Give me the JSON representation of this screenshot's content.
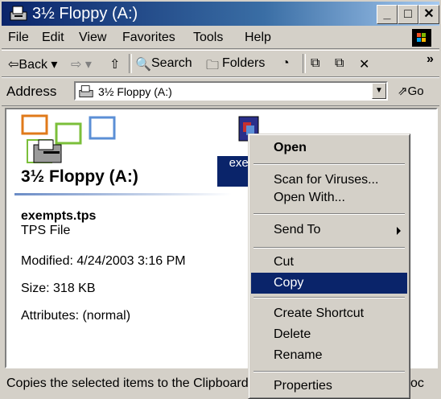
{
  "window": {
    "title": "3½ Floppy (A:)"
  },
  "menu": [
    "File",
    "Edit",
    "View",
    "Favorites",
    "Tools",
    "Help"
  ],
  "toolbar": {
    "back": "⇦Back ▾",
    "forward": "⇨ ▾",
    "search": "Search",
    "folders": "Folders",
    "more": "»"
  },
  "address": {
    "label": "Address",
    "value": "3½ Floppy (A:)",
    "go": "Go"
  },
  "left_panel": {
    "title": "3½ Floppy (A:)",
    "file_name": "exempts.tps",
    "file_type": "TPS File",
    "modified": "Modified: 4/24/2003 3:16 PM",
    "size": "Size: 318 KB",
    "attributes": "Attributes: (normal)"
  },
  "selected_file": {
    "label": "exempts.tps"
  },
  "context_menu": {
    "open": "Open",
    "scan": "Scan for Viruses...",
    "open_with": "Open With...",
    "send_to": "Send To",
    "cut": "Cut",
    "copy": "Copy",
    "create_shortcut": "Create Shortcut",
    "delete": "Delete",
    "rename": "Rename",
    "properties": "Properties"
  },
  "status": {
    "text": "Copies the selected items to the Clipboard",
    "right": "oc"
  },
  "colors": {
    "titlebar": "#0a246a",
    "selection": "#0a246a",
    "chrome": "#d4d0c8"
  }
}
